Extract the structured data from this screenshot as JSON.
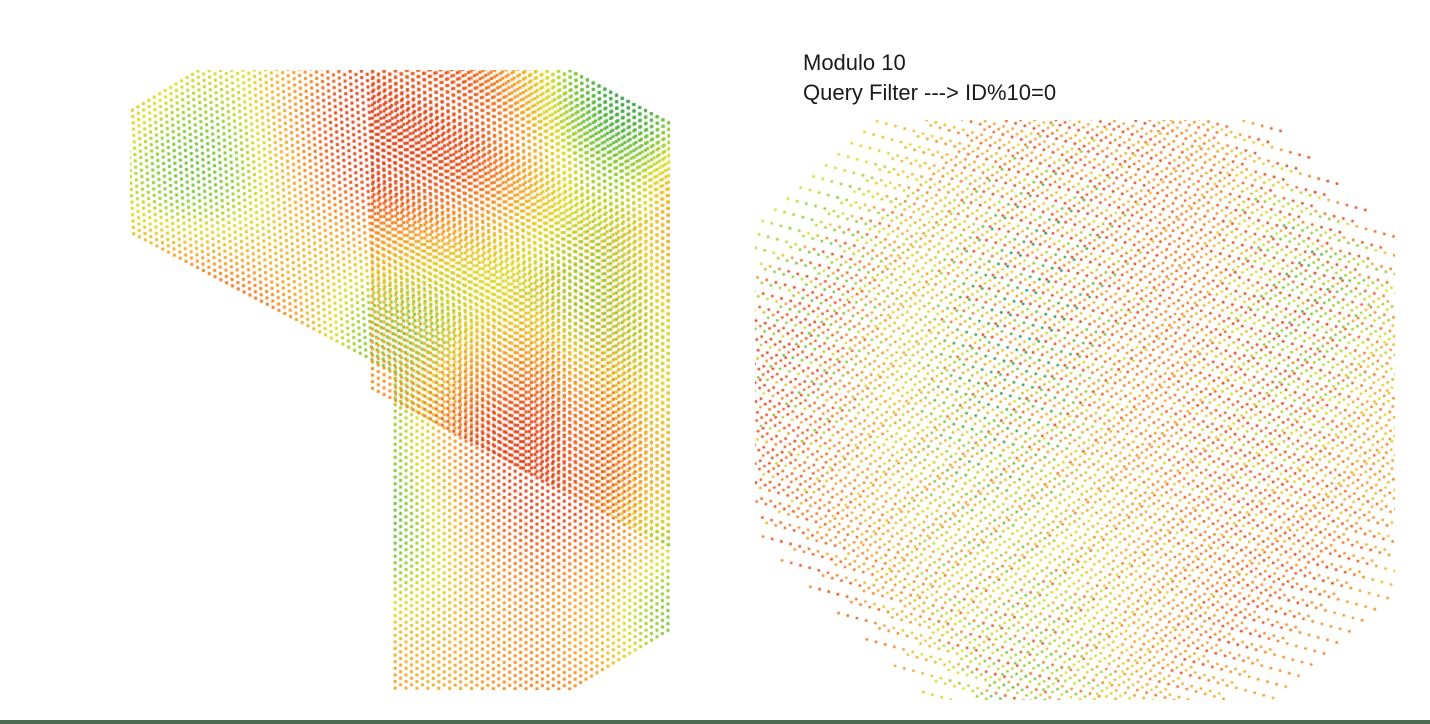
{
  "left": {
    "description": "Dense 3D point-cloud cube colored by scalar field (rainbow colormap).",
    "view": {
      "kind": "isometric-cube",
      "colormap": [
        "#1a3cff",
        "#1f8f3a",
        "#7ec23a",
        "#e6e62a",
        "#f28c1a",
        "#e64a19"
      ]
    }
  },
  "right": {
    "title_line1": "Modulo 10",
    "title_line2": "Query Filter ---> ID%10=0",
    "description": "Same cube, subsampled so only 1-in-10 points remain, and rotated to look along a body diagonal.",
    "filter": {
      "modulo": 10,
      "expression": "ID%10=0"
    }
  },
  "colors": {
    "page_bg": "#ffffff",
    "text": "#1a1a1a",
    "bottom_bar": "#4a6b50"
  }
}
